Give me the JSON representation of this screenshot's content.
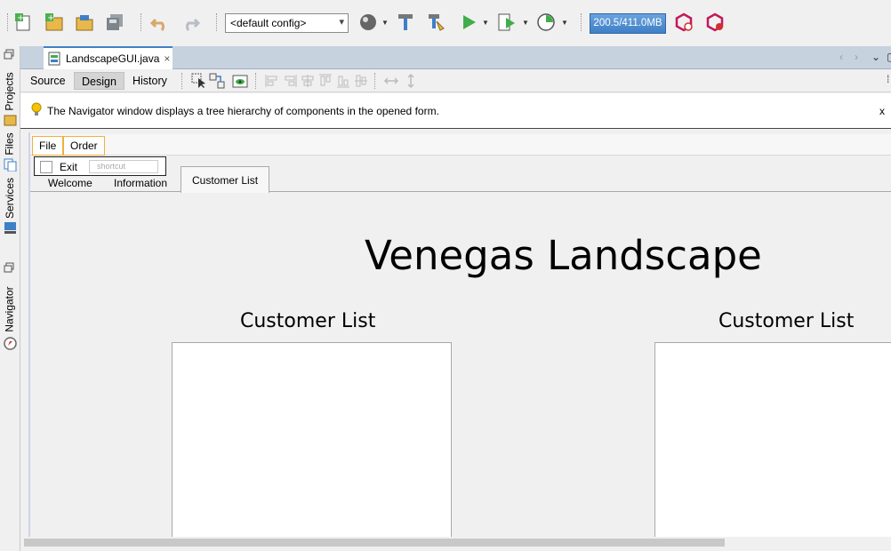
{
  "toolbar": {
    "icons": [
      "new-file-icon",
      "new-project-icon",
      "open-project-icon",
      "save-all-icon",
      "undo-icon",
      "redo-icon",
      "globe-icon",
      "build-icon",
      "clean-build-icon",
      "run-icon",
      "debug-icon",
      "profile-icon",
      "gc-icon",
      "profile-snapshot-icon"
    ],
    "config_value": "<default config>",
    "memory_label": "200.5/411.0MB",
    "accent": "#3f7fc6"
  },
  "sidebar": {
    "projects": "Projects",
    "files": "Files",
    "services": "Services",
    "navigator": "Navigator"
  },
  "editor": {
    "file_tab": "LandscapeGUI.java",
    "close_glyph": "×",
    "modes": [
      "Source",
      "Design",
      "History"
    ],
    "active_mode": "Design"
  },
  "info": {
    "message": "The Navigator window displays a tree hierarchy of components in the opened form.",
    "close": "x"
  },
  "form": {
    "menus": [
      "File",
      "Order"
    ],
    "popup": {
      "item": "Exit",
      "shortcut_placeholder": "shortcut"
    },
    "tabs": [
      "Welcome",
      "Information",
      "Customer List"
    ],
    "active_tab": "Customer List",
    "heading": "Venegas Landscape",
    "list_left_title": "Customer List",
    "list_right_title": "Customer List"
  }
}
